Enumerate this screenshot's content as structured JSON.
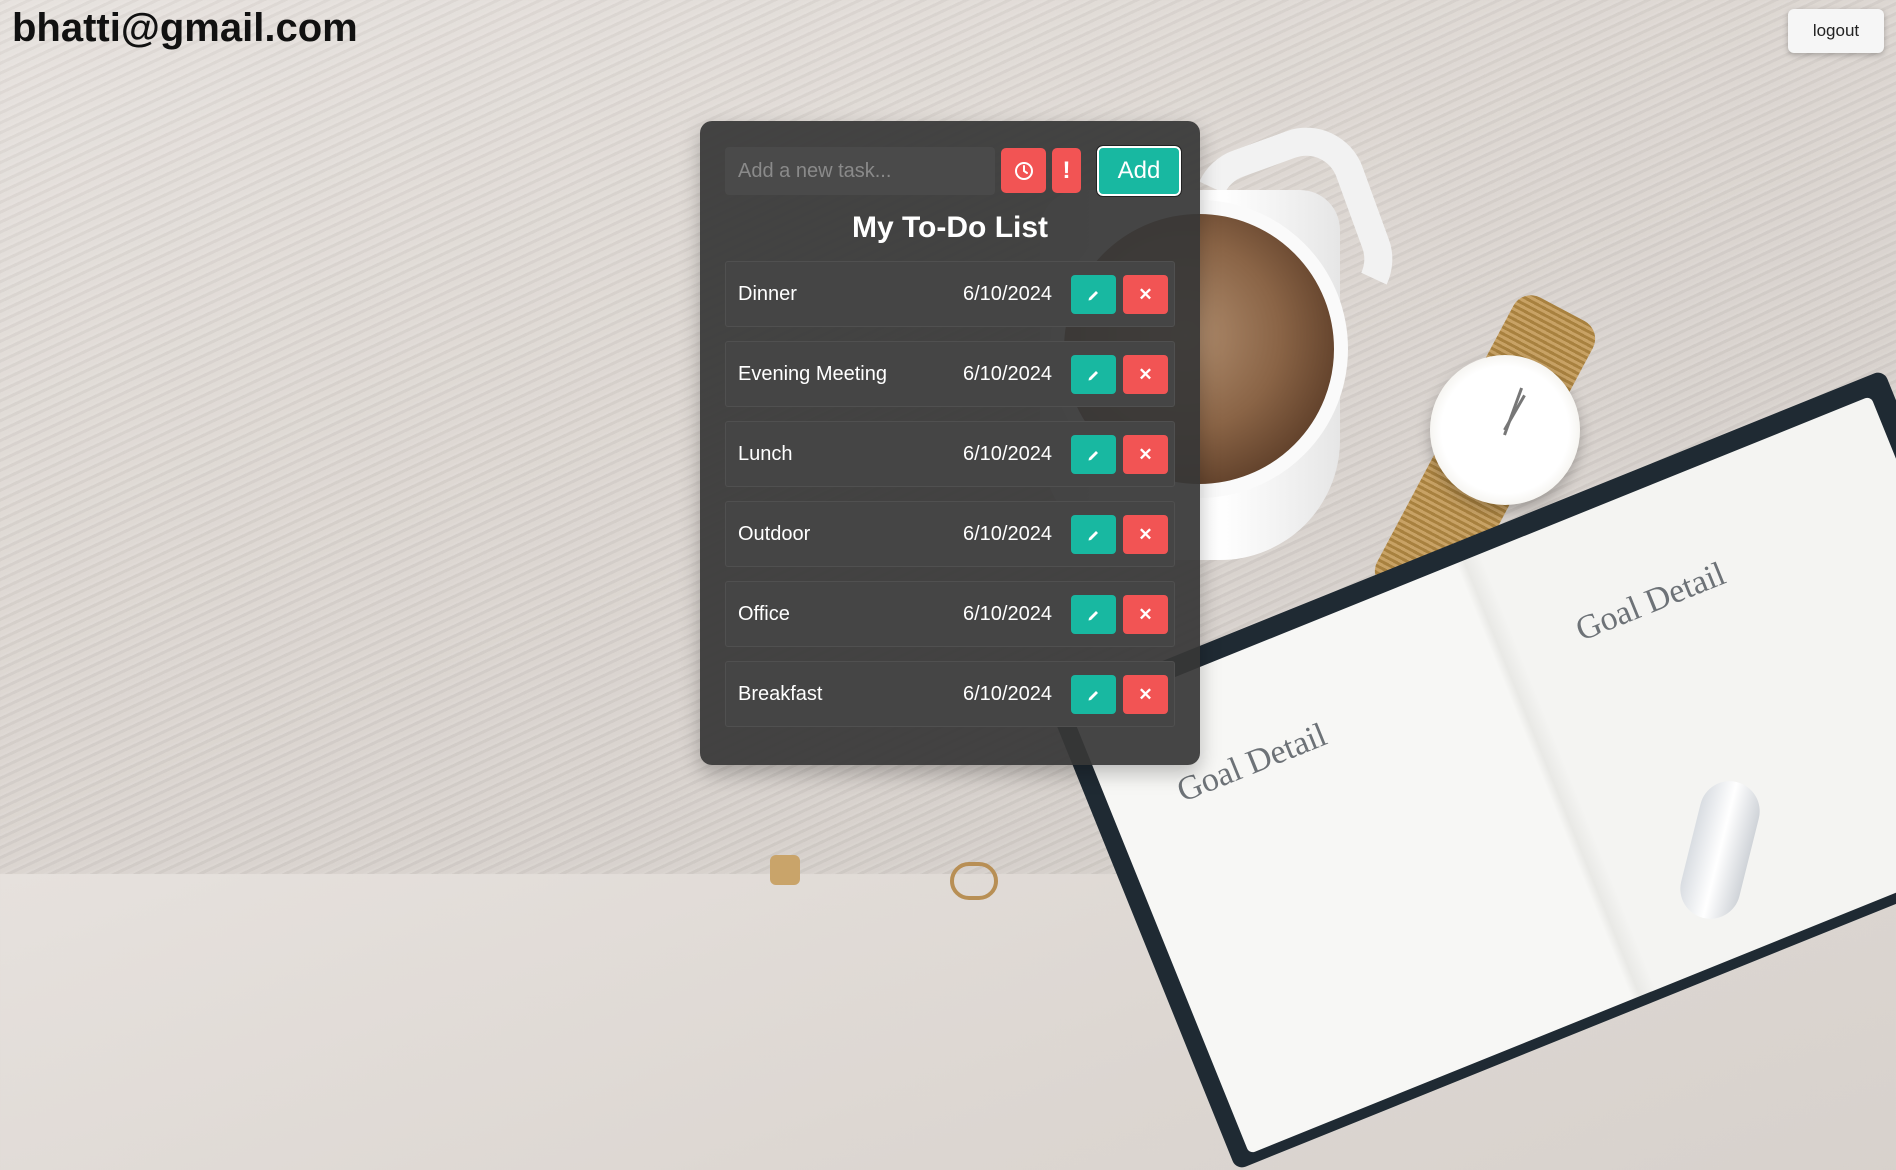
{
  "header": {
    "user_email": "bhatti@gmail.com",
    "logout_label": "logout"
  },
  "add_task": {
    "placeholder": "Add a new task...",
    "value": "",
    "priority_label": "!",
    "add_label": "Add"
  },
  "list": {
    "title": "My To-Do List",
    "delete_label": "✕",
    "items": [
      {
        "name": "Dinner",
        "date": "6/10/2024"
      },
      {
        "name": "Evening Meeting",
        "date": "6/10/2024"
      },
      {
        "name": "Lunch",
        "date": "6/10/2024"
      },
      {
        "name": "Outdoor",
        "date": "6/10/2024"
      },
      {
        "name": "Office",
        "date": "6/10/2024"
      },
      {
        "name": "Breakfast",
        "date": "6/10/2024"
      }
    ]
  },
  "background": {
    "notebook_heading": "Goal Detail"
  },
  "icons": {
    "time": "clock-icon",
    "edit": "pencil-icon",
    "delete": "close-icon"
  },
  "colors": {
    "accent_teal": "#18b8a1",
    "accent_red": "#f25454",
    "panel": "#373737"
  }
}
